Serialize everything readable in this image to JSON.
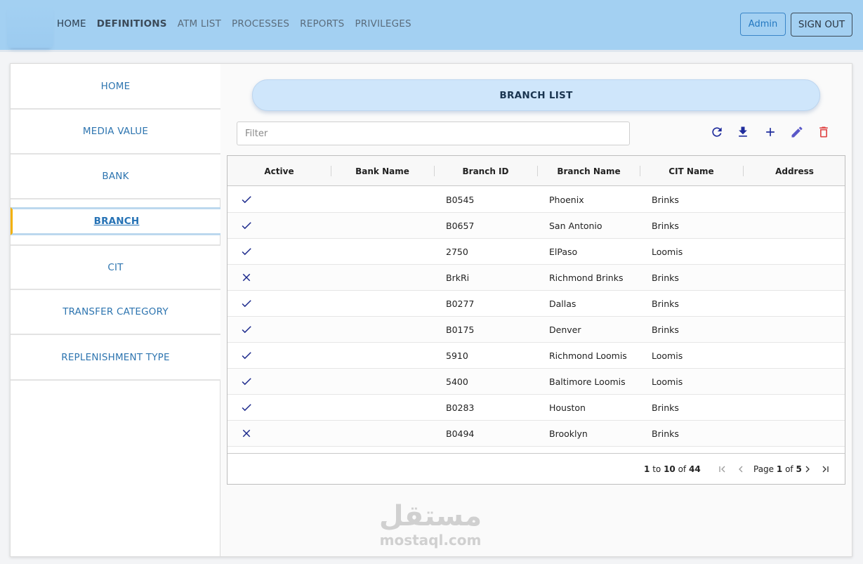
{
  "nav": {
    "items": [
      "HOME",
      "DEFINITIONS",
      "ATM LIST",
      "PROCESSES",
      "REPORTS",
      "PRIVILEGES"
    ],
    "admin_label": "Admin",
    "signout_label": "SIGN OUT"
  },
  "sidebar": {
    "items": [
      "HOME",
      "MEDIA VALUE",
      "BANK",
      "BRANCH",
      "CIT",
      "TRANSFER CATEGORY",
      "REPLENISHMENT TYPE"
    ],
    "active": "BRANCH"
  },
  "main": {
    "title": "BRANCH LIST",
    "filter_placeholder": "Filter",
    "toolbar": [
      "refresh-icon",
      "download-icon",
      "add-icon",
      "edit-icon",
      "delete-icon"
    ]
  },
  "grid": {
    "columns": [
      "Active",
      "Bank Name",
      "Branch ID",
      "Branch Name",
      "CIT Name",
      "Address"
    ],
    "rows": [
      {
        "active": true,
        "bank_name": "",
        "branch_id": "B0545",
        "branch_name": "Phoenix",
        "cit_name": "Brinks",
        "address": ""
      },
      {
        "active": true,
        "bank_name": "",
        "branch_id": "B0657",
        "branch_name": "San Antonio",
        "cit_name": "Brinks",
        "address": ""
      },
      {
        "active": true,
        "bank_name": "",
        "branch_id": "2750",
        "branch_name": "ElPaso",
        "cit_name": "Loomis",
        "address": ""
      },
      {
        "active": false,
        "bank_name": "",
        "branch_id": "BrkRi",
        "branch_name": "Richmond Brinks",
        "cit_name": "Brinks",
        "address": ""
      },
      {
        "active": true,
        "bank_name": "",
        "branch_id": "B0277",
        "branch_name": "Dallas",
        "cit_name": "Brinks",
        "address": ""
      },
      {
        "active": true,
        "bank_name": "",
        "branch_id": "B0175",
        "branch_name": "Denver",
        "cit_name": "Brinks",
        "address": ""
      },
      {
        "active": true,
        "bank_name": "",
        "branch_id": "5910",
        "branch_name": "Richmond Loomis",
        "cit_name": "Loomis",
        "address": ""
      },
      {
        "active": true,
        "bank_name": "",
        "branch_id": "5400",
        "branch_name": "Baltimore Loomis",
        "cit_name": "Loomis",
        "address": ""
      },
      {
        "active": true,
        "bank_name": "",
        "branch_id": "B0283",
        "branch_name": "Houston",
        "cit_name": "Brinks",
        "address": ""
      },
      {
        "active": false,
        "bank_name": "",
        "branch_id": "B0494",
        "branch_name": "Brooklyn",
        "cit_name": "Brinks",
        "address": ""
      }
    ],
    "footer": {
      "range_start": "1",
      "range_to": "to",
      "range_end": "10",
      "range_of": "of",
      "total": "44",
      "page_word": "Page",
      "page": "1",
      "page_of": "of",
      "page_total": "5"
    }
  },
  "watermark": {
    "arabic": "مستقل",
    "latin": "mostaql.com"
  },
  "colors": {
    "topbar": "#a3d0f2",
    "accent": "#2e75b0",
    "check": "#1c2a8c",
    "delete": "#e04848",
    "active_marker": "#f2b000"
  }
}
